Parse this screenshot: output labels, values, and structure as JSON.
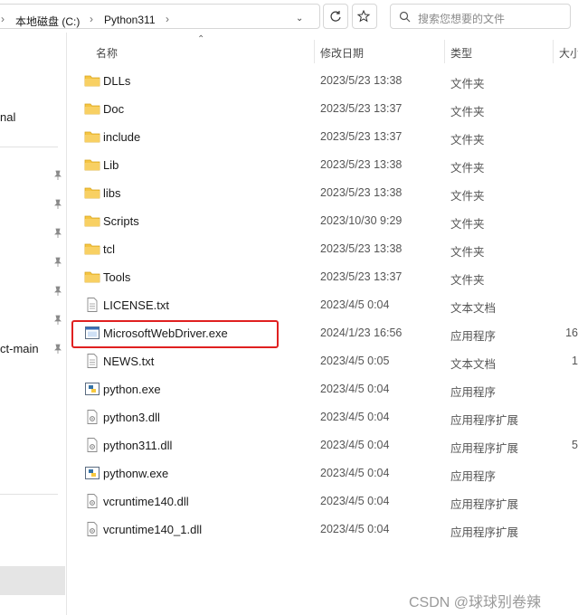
{
  "breadcrumb": {
    "drive": "本地磁盘 (C:)",
    "folder": "Python311"
  },
  "search": {
    "placeholder": "搜索您想要的文件"
  },
  "nav_pane": {
    "partial_item_1": "nal",
    "partial_item_2": "ct-main"
  },
  "columns": {
    "name": "名称",
    "date": "修改日期",
    "type": "类型",
    "size": "大小"
  },
  "files": [
    {
      "name": "DLLs",
      "date": "2023/5/23 13:38",
      "type": "文件夹",
      "size": "",
      "icon": "folder-icon"
    },
    {
      "name": "Doc",
      "date": "2023/5/23 13:37",
      "type": "文件夹",
      "size": "",
      "icon": "folder-icon"
    },
    {
      "name": "include",
      "date": "2023/5/23 13:37",
      "type": "文件夹",
      "size": "",
      "icon": "folder-icon"
    },
    {
      "name": "Lib",
      "date": "2023/5/23 13:38",
      "type": "文件夹",
      "size": "",
      "icon": "folder-icon"
    },
    {
      "name": "libs",
      "date": "2023/5/23 13:38",
      "type": "文件夹",
      "size": "",
      "icon": "folder-icon"
    },
    {
      "name": "Scripts",
      "date": "2023/10/30 9:29",
      "type": "文件夹",
      "size": "",
      "icon": "folder-icon"
    },
    {
      "name": "tcl",
      "date": "2023/5/23 13:38",
      "type": "文件夹",
      "size": "",
      "icon": "folder-icon"
    },
    {
      "name": "Tools",
      "date": "2023/5/23 13:37",
      "type": "文件夹",
      "size": "",
      "icon": "folder-icon"
    },
    {
      "name": "LICENSE.txt",
      "date": "2023/4/5 0:04",
      "type": "文本文档",
      "size": "",
      "icon": "text-file-icon"
    },
    {
      "name": "MicrosoftWebDriver.exe",
      "date": "2024/1/23 16:56",
      "type": "应用程序",
      "size": "16",
      "icon": "exe-icon"
    },
    {
      "name": "NEWS.txt",
      "date": "2023/4/5 0:05",
      "type": "文本文档",
      "size": "1",
      "icon": "text-file-icon"
    },
    {
      "name": "python.exe",
      "date": "2023/4/5 0:04",
      "type": "应用程序",
      "size": "",
      "icon": "python-exe-icon"
    },
    {
      "name": "python3.dll",
      "date": "2023/4/5 0:04",
      "type": "应用程序扩展",
      "size": "",
      "icon": "dll-icon"
    },
    {
      "name": "python311.dll",
      "date": "2023/4/5 0:04",
      "type": "应用程序扩展",
      "size": "5",
      "icon": "dll-icon"
    },
    {
      "name": "pythonw.exe",
      "date": "2023/4/5 0:04",
      "type": "应用程序",
      "size": "",
      "icon": "python-exe-icon"
    },
    {
      "name": "vcruntime140.dll",
      "date": "2023/4/5 0:04",
      "type": "应用程序扩展",
      "size": "",
      "icon": "dll-icon"
    },
    {
      "name": "vcruntime140_1.dll",
      "date": "2023/4/5 0:04",
      "type": "应用程序扩展",
      "size": "",
      "icon": "dll-icon"
    }
  ],
  "watermark": "CSDN @球球别卷辣",
  "colors": {
    "folder": "#f5c542",
    "highlight_border": "#e02020",
    "selection_bg": "#e5e5e5"
  }
}
